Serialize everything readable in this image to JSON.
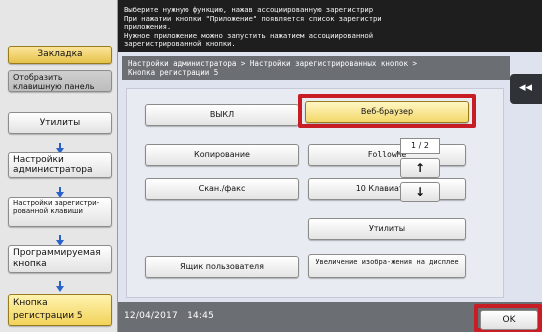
{
  "message": {
    "line1": "Выберите нужную функцию, нажав ассоциированную зарегистрир",
    "line2": "При нажатии кнопки \"Приложение\" появляется список зарегистри",
    "line3": "приложения.",
    "line4": "Нужное приложение можно запустить нажатием ассоциированной",
    "line5": "зарегистрированной кнопки."
  },
  "sidebar": {
    "bookmark": "Закладка",
    "show_keypad": "Отобразить клавишную панель",
    "utilities": "Утилиты",
    "admin_settings": "Настройки администратора",
    "registered_keys": "Настройки зарегистри-рованной клавиши",
    "programmable_key": "Программируемая кнопка",
    "registration_key5": "Кнопка регистрации 5"
  },
  "breadcrumb": {
    "line1": "Настройки администратора > Настройки зарегистрированных кнопок >",
    "line2": "Кнопка регистрации 5"
  },
  "back_tab": {
    "label": "◂◂"
  },
  "functions": {
    "off": "ВЫКЛ",
    "web_browser": "Веб-браузер",
    "copy": "Копирование",
    "followme": "FollowMe",
    "scan_fax": "Скан./факс",
    "ten_keypad": "10 Клавиатура",
    "utilities": "Утилиты",
    "user_box": "Ящик пользователя",
    "enlarge_display": "Увеличение изобра-жения на дисплее"
  },
  "pager": {
    "indicator": "1 / 2",
    "up": "↑",
    "down": "↓"
  },
  "footer": {
    "date": "12/04/2017",
    "time": "14:45",
    "ok": "OK"
  },
  "colors": {
    "highlight": "#c81d25",
    "selected": "#f3d86a",
    "header": "#1e1e1e",
    "breadcrumb": "#6b6f74"
  }
}
